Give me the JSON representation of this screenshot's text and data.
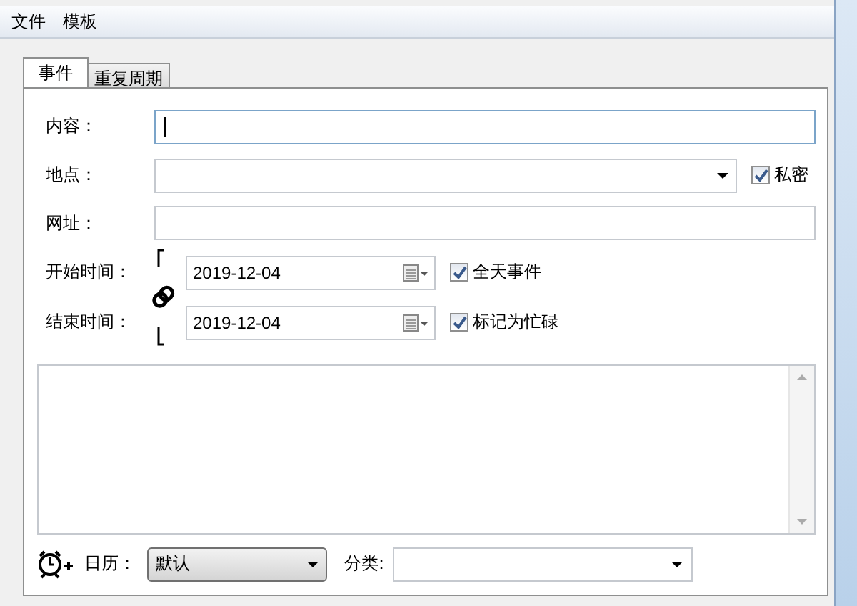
{
  "menu": [
    {
      "label": "文件"
    },
    {
      "label": "模板"
    }
  ],
  "tabs": [
    {
      "label": "事件",
      "selected": true
    },
    {
      "label": "重复周期",
      "selected": false
    }
  ],
  "content": {
    "label": "内容：",
    "focused": true
  },
  "location": {
    "label": "地点：",
    "private": {
      "label": "私密",
      "checked": true
    }
  },
  "url": {
    "label": "网址："
  },
  "start": {
    "label": "开始时间：",
    "value": "2019-12-04",
    "option": {
      "label": "全天事件",
      "checked": true
    }
  },
  "end": {
    "label": "结束时间：",
    "value": "2019-12-04",
    "option": {
      "label": "标记为忙碌",
      "checked": true
    }
  },
  "calendar": {
    "label": "日历：",
    "value": "默认"
  },
  "category": {
    "label": "分类:"
  }
}
